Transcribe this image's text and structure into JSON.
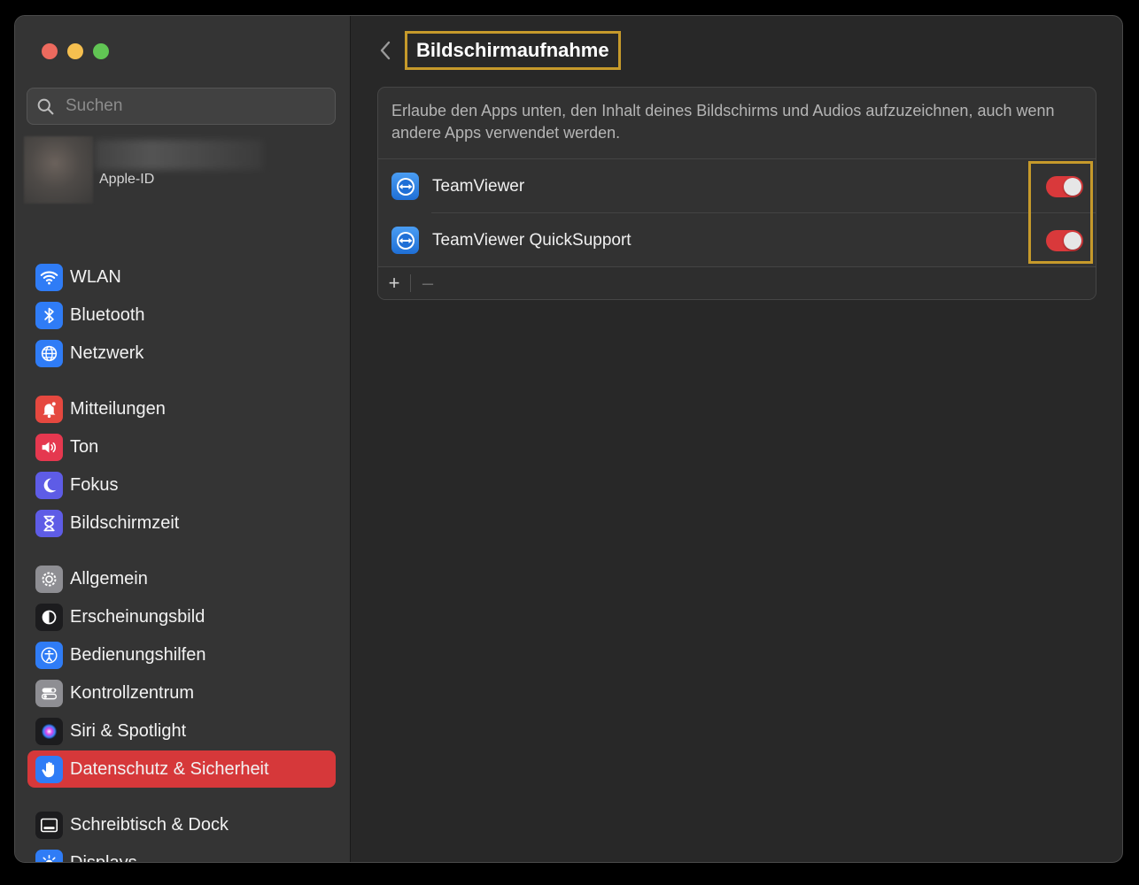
{
  "window": {
    "title": "Bildschirmaufnahme"
  },
  "search": {
    "placeholder": "Suchen"
  },
  "account": {
    "subtitle": "Apple-ID"
  },
  "sidebar": {
    "items": [
      {
        "label": "WLAN",
        "icon": "wifi-icon",
        "color": "#2f7cf6"
      },
      {
        "label": "Bluetooth",
        "icon": "bluetooth-icon",
        "color": "#2f7cf6"
      },
      {
        "label": "Netzwerk",
        "icon": "globe-icon",
        "color": "#2f7cf6"
      },
      {
        "label": "Mitteilungen",
        "icon": "bell-icon",
        "color": "#e5483f"
      },
      {
        "label": "Ton",
        "icon": "speaker-icon",
        "color": "#e5384f"
      },
      {
        "label": "Fokus",
        "icon": "moon-icon",
        "color": "#5e5ce6"
      },
      {
        "label": "Bildschirmzeit",
        "icon": "hourglass-icon",
        "color": "#5e5ce6"
      },
      {
        "label": "Allgemein",
        "icon": "gear-icon",
        "color": "#8e8e93"
      },
      {
        "label": "Erscheinungsbild",
        "icon": "appearance-icon",
        "color": "#1c1c1e"
      },
      {
        "label": "Bedienungshilfen",
        "icon": "accessibility-icon",
        "color": "#2f7cf6"
      },
      {
        "label": "Kontrollzentrum",
        "icon": "control-center-icon",
        "color": "#8e8e93"
      },
      {
        "label": "Siri & Spotlight",
        "icon": "siri-icon",
        "color": "#1c1c1e"
      },
      {
        "label": "Datenschutz & Sicherheit",
        "icon": "hand-icon",
        "color": "#2f7cf6",
        "active": true
      },
      {
        "label": "Schreibtisch & Dock",
        "icon": "dock-icon",
        "color": "#1c1c1e"
      },
      {
        "label": "Displays",
        "icon": "sun-icon",
        "color": "#2f7cf6"
      }
    ]
  },
  "main": {
    "description": "Erlaube den Apps unten, den Inhalt deines Bildschirms und Audios aufzuzeichnen, auch wenn andere Apps verwendet werden.",
    "apps": [
      {
        "name": "TeamViewer",
        "enabled": true
      },
      {
        "name": "TeamViewer QuickSupport",
        "enabled": true
      }
    ],
    "add_label": "+",
    "remove_label": "–"
  },
  "colors": {
    "accent": "#d6383a",
    "highlight": "#c69a2b",
    "toggle_on": "#d9393b"
  }
}
